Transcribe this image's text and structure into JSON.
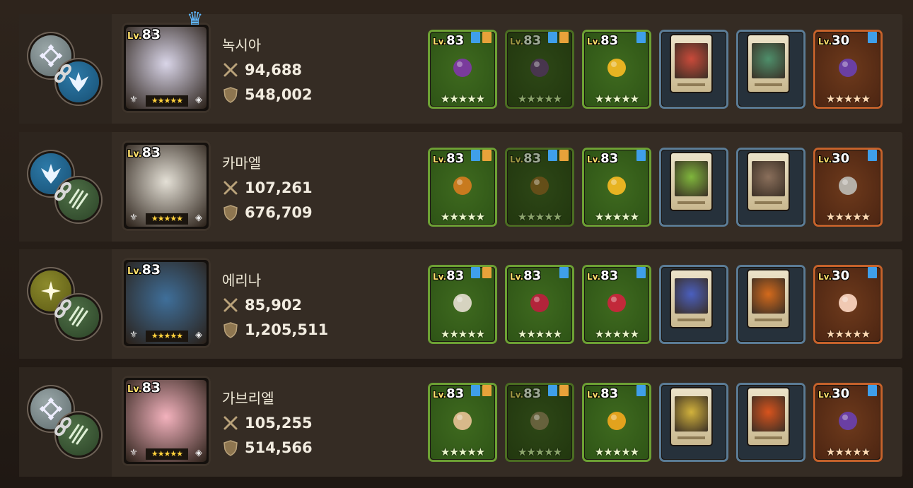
{
  "rows": [
    {
      "name": "녹시아",
      "attack": "94,688",
      "defense": "548,002",
      "level_prefix": "Lv.",
      "level": "83",
      "has_crown": true,
      "symbols": [
        "grey",
        "blue"
      ],
      "portrait_color": "#d9d5e8",
      "equipment": [
        {
          "type": "weapon",
          "level": "83",
          "dim": false,
          "color": "#7a3b9c"
        },
        {
          "type": "weapon",
          "level": "83",
          "dim": true,
          "color": "#5c2b75"
        },
        {
          "type": "accessory",
          "level": "83",
          "dim": false,
          "color": "#e7b322"
        },
        {
          "type": "card",
          "color": "#c94a3a"
        },
        {
          "type": "card",
          "color": "#4e8f6b"
        },
        {
          "type": "relic",
          "level": "30",
          "color": "#6a3fa3"
        }
      ]
    },
    {
      "name": "카마엘",
      "attack": "107,261",
      "defense": "676,709",
      "level_prefix": "Lv.",
      "level": "83",
      "has_crown": false,
      "symbols": [
        "blue",
        "green"
      ],
      "portrait_color": "#e4e0d6",
      "equipment": [
        {
          "type": "weapon",
          "level": "83",
          "dim": false,
          "color": "#c87a1e"
        },
        {
          "type": "weapon",
          "level": "83",
          "dim": true,
          "color": "#8b551a"
        },
        {
          "type": "accessory",
          "level": "83",
          "dim": false,
          "color": "#e7b322"
        },
        {
          "type": "card",
          "color": "#7fb63c"
        },
        {
          "type": "card",
          "color": "#8a6f5b"
        },
        {
          "type": "relic",
          "level": "30",
          "color": "#b5b0a8"
        }
      ]
    },
    {
      "name": "에리나",
      "attack": "85,902",
      "defense": "1,205,511",
      "level_prefix": "Lv.",
      "level": "83",
      "has_crown": false,
      "symbols": [
        "olive",
        "green"
      ],
      "portrait_color": "#3f6f9a",
      "equipment": [
        {
          "type": "weapon",
          "level": "83",
          "dim": false,
          "color": "#d6d3c0"
        },
        {
          "type": "armor",
          "level": "83",
          "dim": false,
          "color": "#b3243a"
        },
        {
          "type": "accessory",
          "level": "83",
          "dim": false,
          "color": "#c2293a"
        },
        {
          "type": "card",
          "color": "#4a5fbf"
        },
        {
          "type": "card",
          "color": "#d46a1c"
        },
        {
          "type": "relic",
          "level": "30",
          "color": "#f0c9b3"
        }
      ]
    },
    {
      "name": "가브리엘",
      "attack": "105,255",
      "defense": "514,566",
      "level_prefix": "Lv.",
      "level": "83",
      "has_crown": false,
      "symbols": [
        "grey",
        "green"
      ],
      "portrait_color": "#f3b2bd",
      "equipment": [
        {
          "type": "weapon",
          "level": "83",
          "dim": false,
          "color": "#d8b98a"
        },
        {
          "type": "weapon",
          "level": "83",
          "dim": true,
          "color": "#8e7556"
        },
        {
          "type": "accessory",
          "level": "83",
          "dim": false,
          "color": "#e2a21d"
        },
        {
          "type": "card",
          "color": "#d2b23c"
        },
        {
          "type": "card",
          "color": "#d8531d"
        },
        {
          "type": "relic",
          "level": "30",
          "color": "#6a3fa3"
        }
      ]
    }
  ],
  "star_glyphs": "★★★★★",
  "icons": {
    "attack": "crossed-swords-icon",
    "defense": "shield-icon",
    "crown": "crown-icon",
    "link": "chain-link-icon"
  },
  "colors": {
    "slot_green": "#6da134",
    "slot_blue": "#5b7c96",
    "slot_orange": "#c6622b",
    "tag_blue": "#3f9fea",
    "tag_orange": "#e8a23a"
  }
}
